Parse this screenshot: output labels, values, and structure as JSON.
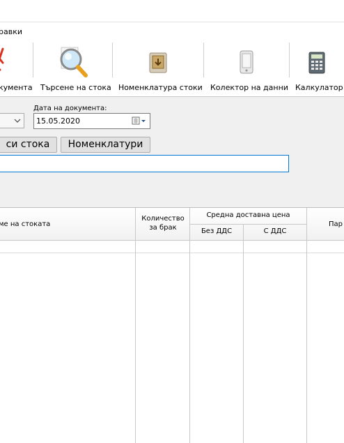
{
  "menu": {
    "item_label": "равки"
  },
  "toolbar": {
    "items": [
      {
        "label": "кумента",
        "icon": "delete-x-icon"
      },
      {
        "label": "Търсене на стока",
        "icon": "magnifier-icon"
      },
      {
        "label": "Номенклатура стоки",
        "icon": "box-icon"
      },
      {
        "label": "Колектор на данни",
        "icon": "mobile-device-icon"
      },
      {
        "label": "Калкулатор",
        "icon": "calculator-icon"
      }
    ]
  },
  "form": {
    "date_label": "Дата на документа:",
    "date_value": "15.05.2020"
  },
  "buttons": {
    "search_goods": "си стока",
    "nomenclatures": "Номенклатури"
  },
  "search": {
    "value": ""
  },
  "table": {
    "headers": {
      "name": "ме на стоката",
      "qty_line1": "Количество",
      "qty_line2": "за брак",
      "avg_price": "Средна доставна цена",
      "no_vat": "Без ДДС",
      "with_vat": "С ДДС",
      "partida": "Пар"
    },
    "rows": []
  },
  "colors": {
    "accent": "#0078d7",
    "x_icon": "#d9301f"
  }
}
